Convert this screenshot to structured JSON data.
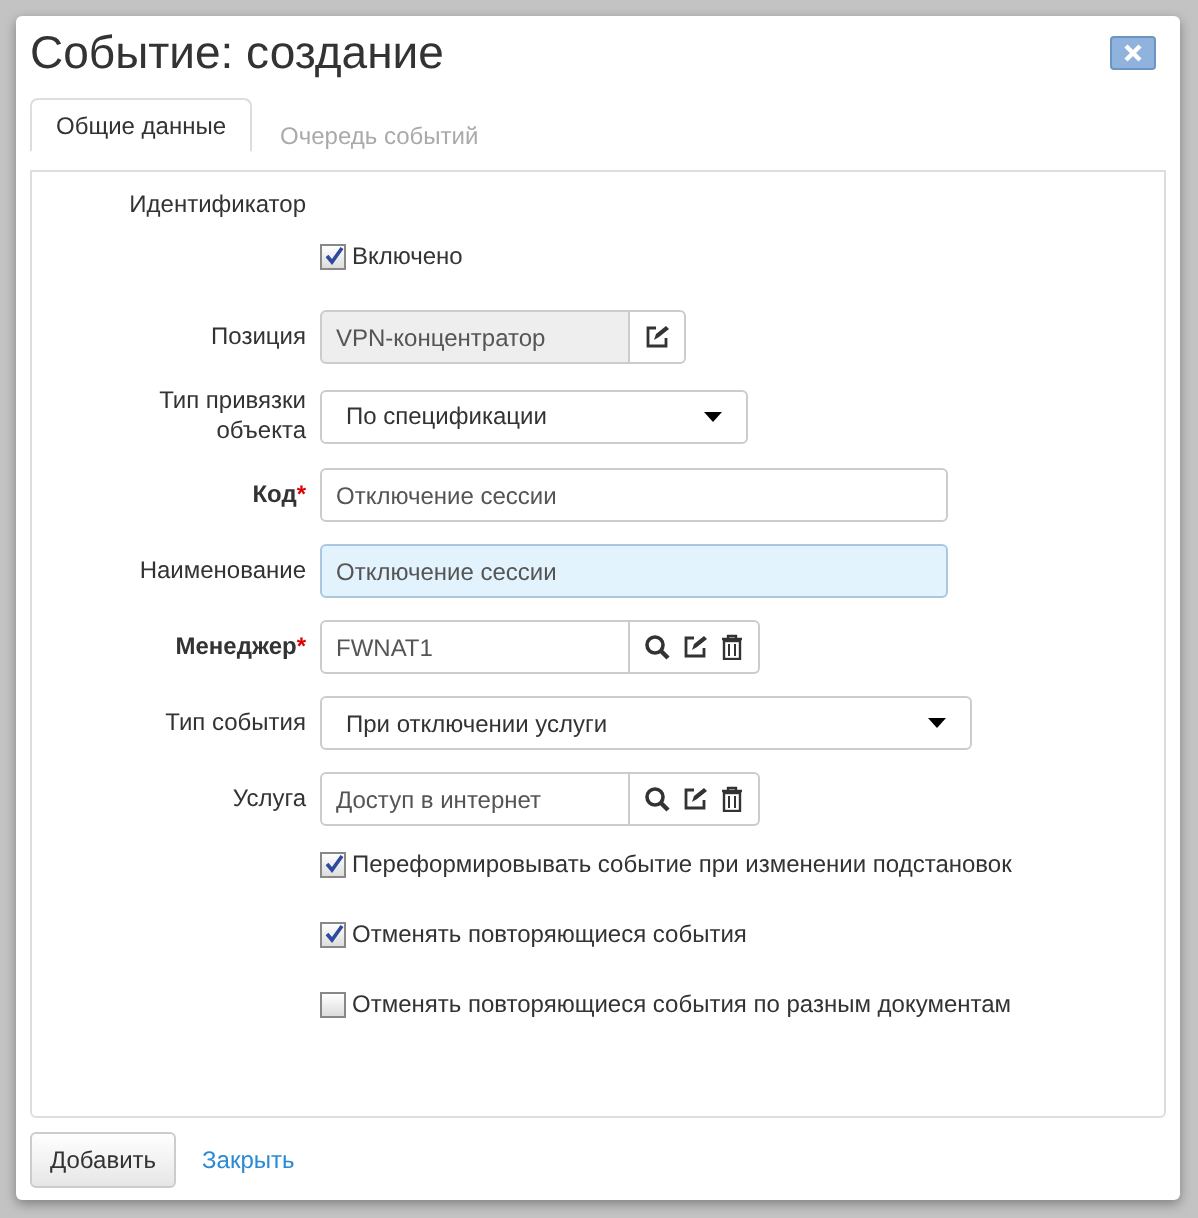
{
  "dialog": {
    "title": "Событие: создание",
    "tabs": [
      {
        "label": "Общие данные",
        "selected": true
      },
      {
        "label": "Очередь событий",
        "selected": false
      }
    ],
    "fields": [
      {
        "kind": "label",
        "label": "Идентификатор"
      },
      {
        "kind": "checkbox",
        "text": "Включено",
        "checked": true
      },
      {
        "kind": "readonly",
        "label": "Позиция",
        "value": "VPN-концентратор",
        "actions": [
          {
            "kind": "edit"
          }
        ]
      },
      {
        "kind": "select",
        "label": "Тип привязки объекта",
        "value": "По спецификации",
        "wide": false
      },
      {
        "kind": "text",
        "label": "Код",
        "required": true,
        "required_mark": "*",
        "value": "Отключение сессии",
        "focused": false
      },
      {
        "kind": "text",
        "label": "Наименование",
        "required": false,
        "value": "Отключение сессии",
        "focused": true
      },
      {
        "kind": "lookup",
        "label": "Менеджер",
        "required": true,
        "required_mark": "*",
        "value": "FWNAT1",
        "actions": [
          {
            "kind": "search"
          },
          {
            "kind": "edit"
          },
          {
            "kind": "delete"
          }
        ]
      },
      {
        "kind": "select",
        "label": "Тип события",
        "value": "При отключении услуги",
        "wide": true
      },
      {
        "kind": "lookup",
        "label": "Услуга",
        "required": false,
        "value": "Доступ в интернет",
        "actions": [
          {
            "kind": "search"
          },
          {
            "kind": "edit"
          },
          {
            "kind": "delete"
          }
        ]
      },
      {
        "kind": "checkbox",
        "text": "Переформировывать событие при изменении подстановок",
        "checked": true
      },
      {
        "kind": "checkbox",
        "text": "Отменять повторяющиеся события",
        "checked": true
      },
      {
        "kind": "checkbox",
        "text": "Отменять повторяющиеся события по разным документам",
        "checked": false
      }
    ],
    "buttons": [
      {
        "kind": "button",
        "label": "Добавить"
      },
      {
        "kind": "link",
        "label": "Закрыть"
      }
    ]
  }
}
